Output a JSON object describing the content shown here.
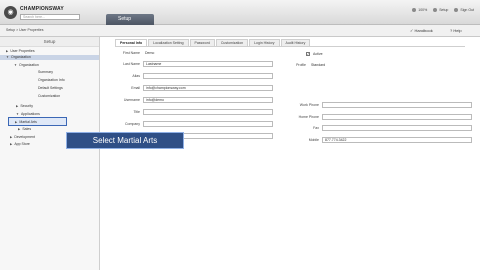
{
  "app": {
    "brand": "CHAMPIONSWAY",
    "search_placeholder": "Search here...",
    "tab_label": "Setup"
  },
  "top_right": {
    "zoom": "100%",
    "setup": "Setup",
    "signout": "Sign Out"
  },
  "subbar": {
    "breadcrumb": "Setup > User Properties",
    "handbook": "Handbook",
    "help": "Help"
  },
  "sidebar": {
    "title": "Setup",
    "items": [
      {
        "label": "User Properties"
      },
      {
        "label": "Organization"
      },
      {
        "label": "Organization"
      },
      {
        "label": "Summary"
      },
      {
        "label": "Organization Info"
      },
      {
        "label": "Default Settings"
      },
      {
        "label": "Customization"
      },
      {
        "label": "Security"
      },
      {
        "label": "Applications"
      },
      {
        "label": "Martial Arts"
      },
      {
        "label": "Sales"
      },
      {
        "label": "Development"
      },
      {
        "label": "App Store"
      }
    ]
  },
  "tooltip": "Select Martial Arts",
  "tabs": [
    "Personal Info",
    "Localization Setting",
    "Password",
    "Customization",
    "Login History",
    "Audit History"
  ],
  "form": {
    "first_name_label": "First Name",
    "first_name": "Demo",
    "last_name_label": "Last Name",
    "last_name": "Lastname",
    "alias_label": "Alias",
    "alias": "",
    "email_label": "Email",
    "email": "info@championsway.com",
    "username_label": "Username",
    "username": "info@demo",
    "title_label": "Title",
    "title": "",
    "company_label": "Company",
    "company": "",
    "department_label": "Department",
    "department": "",
    "active_label": "Active",
    "profile_label": "Profile",
    "profile": "Standard",
    "work_phone_label": "Work Phone",
    "work_phone": "",
    "home_phone_label": "Home Phone",
    "home_phone": "",
    "fax_label": "Fax",
    "fax": "",
    "mobile_label": "Mobile",
    "mobile": "877.774.3422"
  }
}
